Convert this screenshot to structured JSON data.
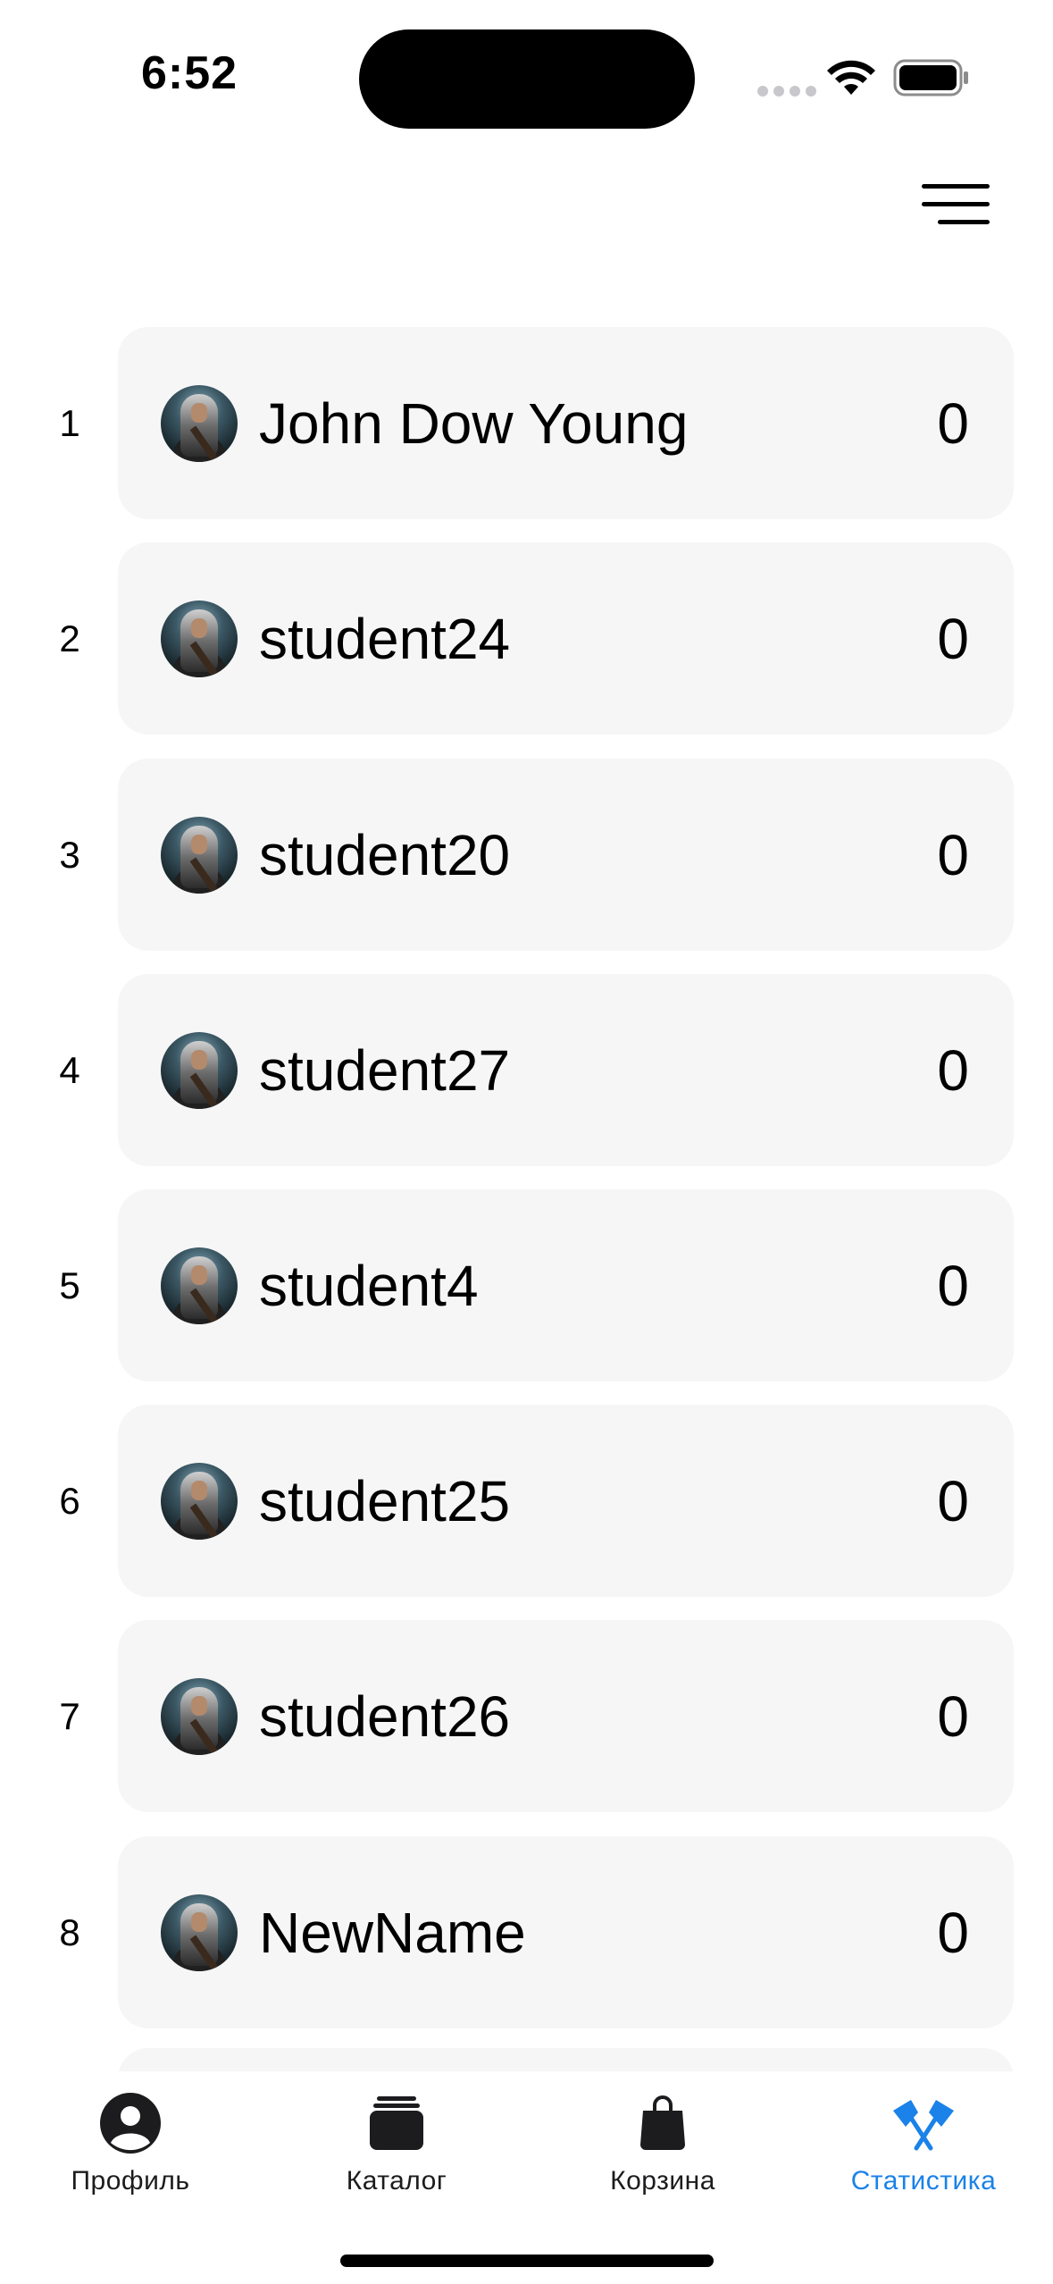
{
  "status_bar": {
    "time": "6:52",
    "icons": [
      "cellular-signal-icon",
      "wifi-icon",
      "battery-icon"
    ]
  },
  "header": {
    "menu_icon": "hamburger-menu-icon"
  },
  "leaderboard": {
    "rows": [
      {
        "rank": "1",
        "name": "John Dow Young",
        "score": "0"
      },
      {
        "rank": "2",
        "name": "student24",
        "score": "0"
      },
      {
        "rank": "3",
        "name": "student20",
        "score": "0"
      },
      {
        "rank": "4",
        "name": "student27",
        "score": "0"
      },
      {
        "rank": "5",
        "name": "student4",
        "score": "0"
      },
      {
        "rank": "6",
        "name": "student25",
        "score": "0"
      },
      {
        "rank": "7",
        "name": "student26",
        "score": "0"
      },
      {
        "rank": "8",
        "name": "NewName",
        "score": "0"
      }
    ]
  },
  "tab_bar": {
    "accent_color": "#1a82e8",
    "tabs": [
      {
        "label": "Профиль",
        "icon": "profile-icon",
        "active": false
      },
      {
        "label": "Каталог",
        "icon": "catalog-stack-icon",
        "active": false
      },
      {
        "label": "Корзина",
        "icon": "shopping-bag-icon",
        "active": false
      },
      {
        "label": "Статистика",
        "icon": "crossed-flags-icon",
        "active": true
      }
    ]
  }
}
